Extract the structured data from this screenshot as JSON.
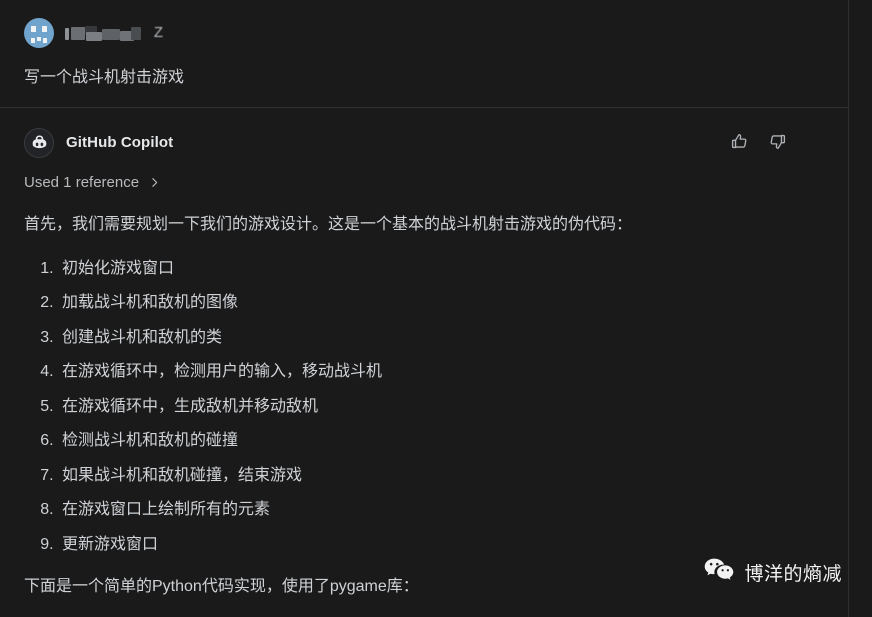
{
  "theme": {
    "background": "#1a1a1a",
    "text": "#cfd2d6",
    "muted": "#b8babd",
    "divider": "#303030",
    "panel_border": "#2e2e2e",
    "user_avatar_bg": "#71a4cd",
    "user_avatar_fg": "#f0f2f4"
  },
  "user_turn": {
    "avatar_icon": "identicon-invader-avatar",
    "username": "",
    "username_redacted": true,
    "username_tail_glyph": "Z",
    "prompt": "写一个战斗机射击游戏"
  },
  "assistant_turn": {
    "avatar_icon": "github-copilot-icon",
    "name": "GitHub Copilot",
    "feedback": {
      "thumbs_up_icon": "thumbs-up-icon",
      "thumbs_down_icon": "thumbs-down-icon"
    },
    "reference": {
      "label": "Used 1 reference",
      "chevron_icon": "chevron-right-icon"
    },
    "intro_paragraph": "首先，我们需要规划一下我们的游戏设计。这是一个基本的战斗机射击游戏的伪代码：",
    "steps": [
      "初始化游戏窗口",
      "加载战斗机和敌机的图像",
      "创建战斗机和敌机的类",
      "在游戏循环中，检测用户的输入，移动战斗机",
      "在游戏循环中，生成敌机并移动敌机",
      "检测战斗机和敌机的碰撞",
      "如果战斗机和敌机碰撞，结束游戏",
      "在游戏窗口上绘制所有的元素",
      "更新游戏窗口"
    ],
    "closing_paragraph": "下面是一个简单的Python代码实现，使用了pygame库："
  },
  "watermark": {
    "icon": "wechat-icon",
    "text": "博洋的熵减"
  }
}
